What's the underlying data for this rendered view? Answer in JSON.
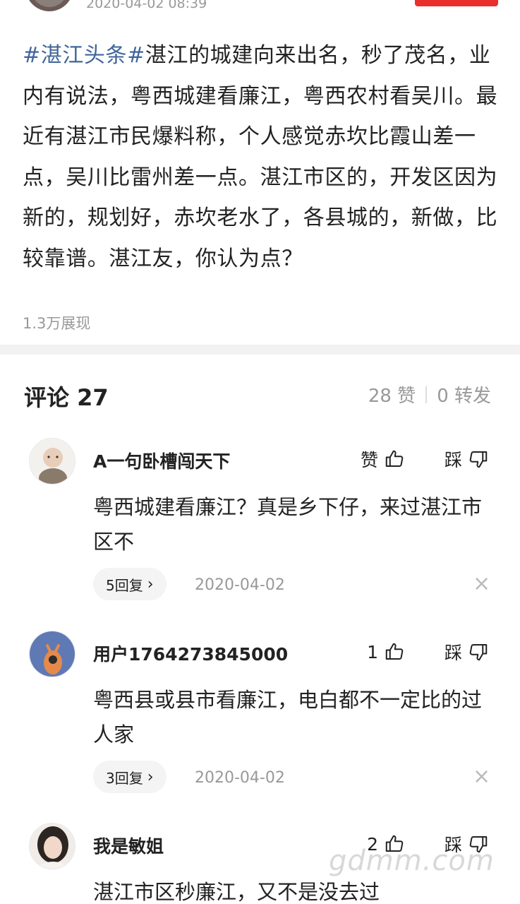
{
  "post": {
    "time": "2020-04-02 08:39",
    "hashtag": "#湛江头条#",
    "text": "湛江的城建向来出名，秒了茂名，业内有说法，粤西城建看廉江，粤西农村看吴川。最近有湛江市民爆料称，个人感觉赤坎比霞山差一点，吴川比雷州差一点。湛江市区的，开发区因为新的，规划好，赤坎老水了，各县城的，新做，比较靠谱。湛江友，你认为点？",
    "impressions": "1.3万展现"
  },
  "comments_header": {
    "title": "评论 27",
    "likes": "28 赞",
    "shares": "0 转发"
  },
  "comments": [
    {
      "name": "A一句卧槽闯天下",
      "like_label": "赞",
      "dislike_label": "踩",
      "text": "粤西城建看廉江？真是乡下仔，来过湛江市区不",
      "replies": "5回复",
      "date": "2020-04-02"
    },
    {
      "name": "用户1764273845000",
      "like_label": "1",
      "dislike_label": "踩",
      "text": "粤西县或县市看廉江，电白都不一定比的过人家",
      "replies": "3回复",
      "date": "2020-04-02"
    },
    {
      "name": "我是敏姐",
      "like_label": "2",
      "dislike_label": "踩",
      "text": "湛江市区秒廉江，又不是没去过"
    }
  ],
  "icons": {
    "like": "thumb-up-icon",
    "dislike": "thumb-down-icon",
    "chevron": "chevron-right-icon",
    "close": "close-icon"
  },
  "colors": {
    "hashtag": "#406599",
    "follow_button": "#e9302d",
    "muted_text": "#999999"
  },
  "watermark": "gdmm.com"
}
